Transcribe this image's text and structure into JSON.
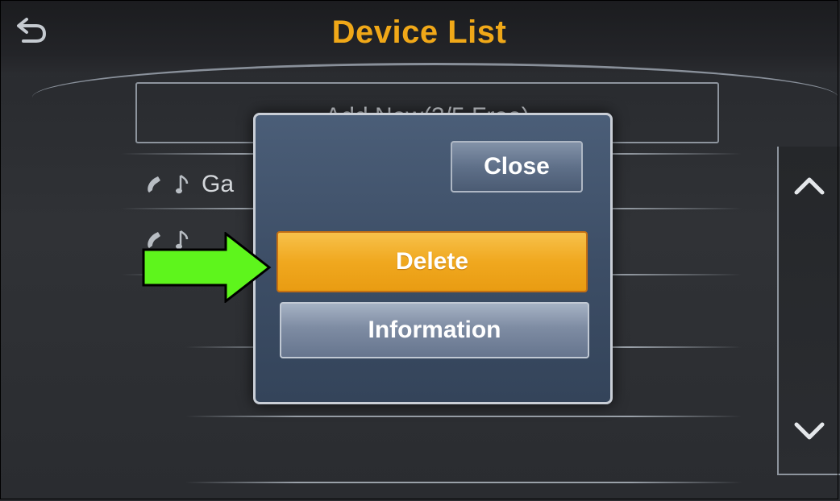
{
  "header": {
    "title": "Device List",
    "back_icon": "back-arrow-icon"
  },
  "list": {
    "add_new_label": "Add New(3/5 Free)",
    "rows": [
      {
        "label": "Ga",
        "icons": [
          "phone-icon",
          "music-note-icon"
        ]
      },
      {
        "label": "",
        "icons": [
          "phone-icon",
          "music-note-icon"
        ]
      }
    ]
  },
  "scroll": {
    "up_icon": "chevron-up-icon",
    "down_icon": "chevron-down-icon"
  },
  "popup": {
    "close_label": "Close",
    "delete_label": "Delete",
    "information_label": "Information"
  },
  "annotation": {
    "arrow_color": "#5ef51c",
    "arrow_icon": "right-arrow-icon"
  },
  "colors": {
    "title": "#f0a818",
    "delete_button": "#f0a81f",
    "popup_background": "#3c4d65"
  }
}
